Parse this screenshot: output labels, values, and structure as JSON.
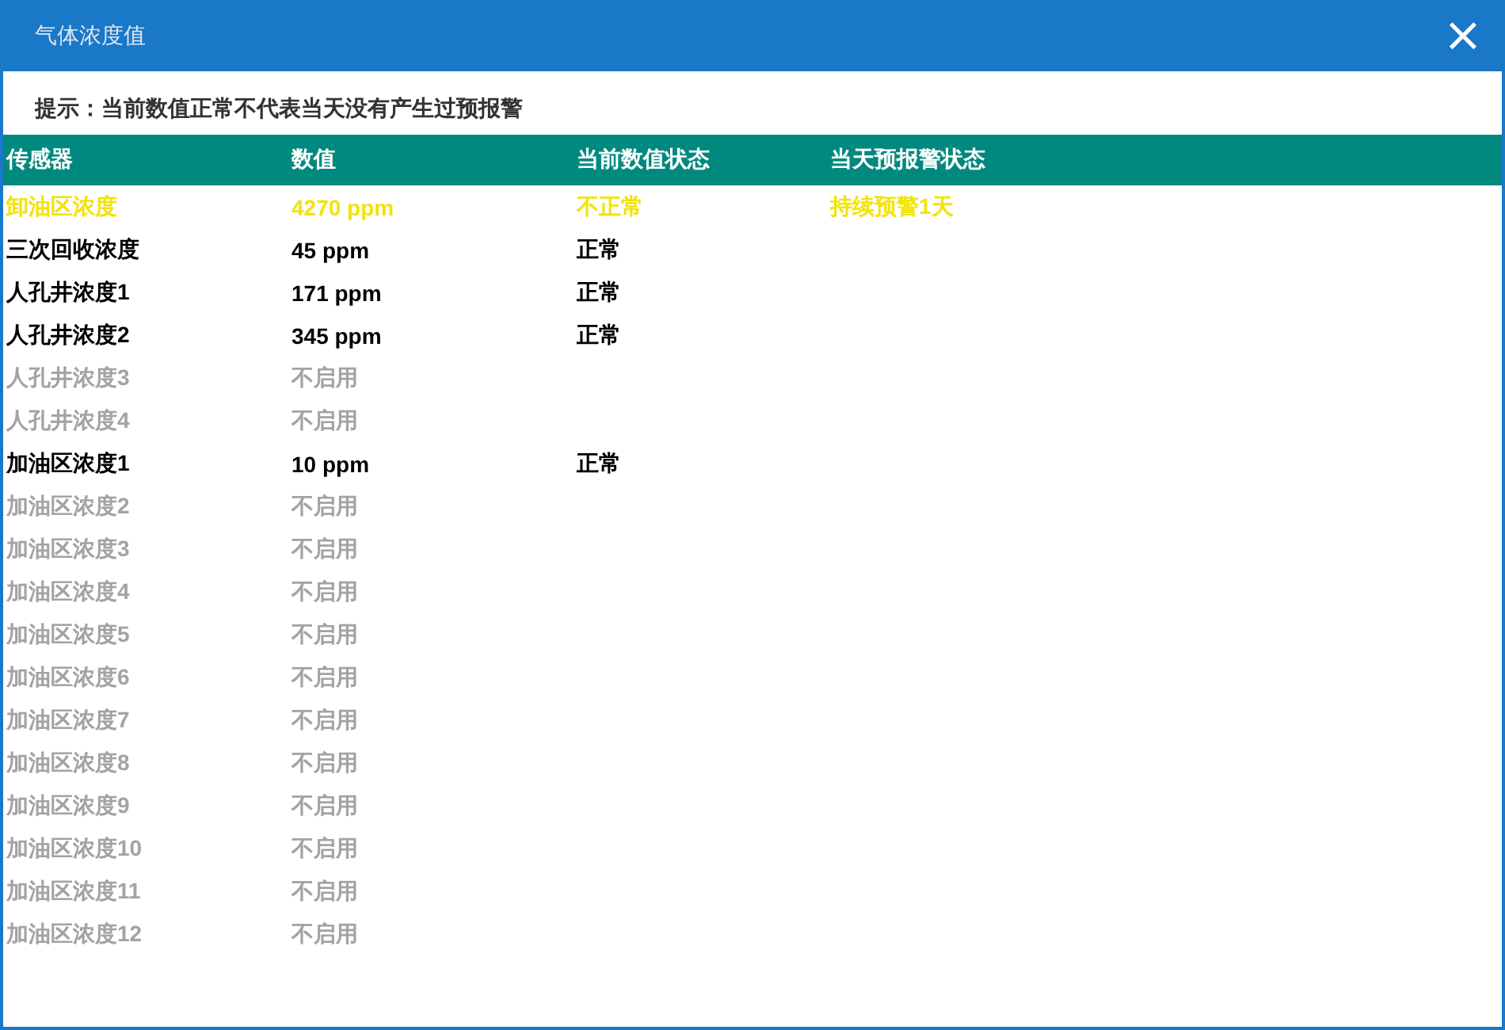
{
  "window": {
    "title": "气体浓度值",
    "close": "×"
  },
  "hint": "提示：当前数值正常不代表当天没有产生过预报警",
  "table": {
    "columns": [
      "传感器",
      "数值",
      "当前数值状态",
      "当天预报警状态"
    ],
    "rows": [
      {
        "kind": "alarm",
        "cells": [
          "卸油区浓度",
          "4270 ppm",
          "不正常",
          "持续预警1天"
        ]
      },
      {
        "kind": "normal",
        "cells": [
          "三次回收浓度",
          "45 ppm",
          "正常"
        ]
      },
      {
        "kind": "normal",
        "cells": [
          "人孔井浓度1",
          "171 ppm",
          "正常"
        ]
      },
      {
        "kind": "normal",
        "cells": [
          "人孔井浓度2",
          "345 ppm",
          "正常"
        ]
      },
      {
        "kind": "disabled",
        "cells": [
          "人孔井浓度3",
          "不启用"
        ]
      },
      {
        "kind": "disabled",
        "cells": [
          "人孔井浓度4",
          "不启用"
        ]
      },
      {
        "kind": "normal",
        "cells": [
          "加油区浓度1",
          "10 ppm",
          "正常"
        ]
      },
      {
        "kind": "disabled",
        "cells": [
          "加油区浓度2",
          "不启用"
        ]
      },
      {
        "kind": "disabled",
        "cells": [
          "加油区浓度3",
          "不启用"
        ]
      },
      {
        "kind": "disabled",
        "cells": [
          "加油区浓度4",
          "不启用"
        ]
      },
      {
        "kind": "disabled",
        "cells": [
          "加油区浓度5",
          "不启用"
        ]
      },
      {
        "kind": "disabled",
        "cells": [
          "加油区浓度6",
          "不启用"
        ]
      },
      {
        "kind": "disabled",
        "cells": [
          "加油区浓度7",
          "不启用"
        ]
      },
      {
        "kind": "disabled",
        "cells": [
          "加油区浓度8",
          "不启用"
        ]
      },
      {
        "kind": "disabled",
        "cells": [
          "加油区浓度9",
          "不启用"
        ]
      },
      {
        "kind": "disabled",
        "cells": [
          "加油区浓度10",
          "不启用"
        ]
      },
      {
        "kind": "disabled",
        "cells": [
          "加油区浓度11",
          "不启用"
        ]
      },
      {
        "kind": "disabled",
        "cells": [
          "加油区浓度12",
          "不启用"
        ]
      }
    ]
  }
}
